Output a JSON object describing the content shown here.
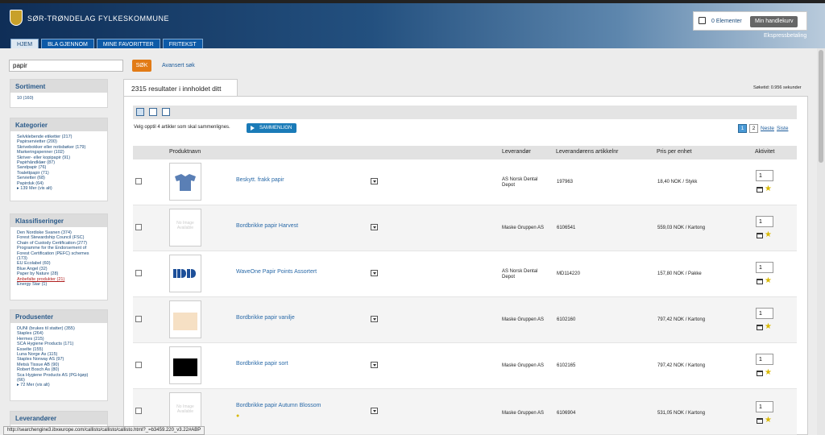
{
  "header": {
    "org_name": "SØR-TRØNDELAG FYLKESKOMMUNE",
    "nav": [
      "HJEM",
      "BLA GJENNOM",
      "MINE FAVORITTER",
      "FRITEKST"
    ],
    "cart_count": "0 Elementer",
    "cart_button": "Min handlekurv",
    "express": "Ekspressbetaling"
  },
  "search": {
    "value": "papir",
    "button": "SØK",
    "advanced": "Avansert søk"
  },
  "sidebar": {
    "sortiment": {
      "title": "Sortiment",
      "items": [
        "10 (160)"
      ]
    },
    "kategorier": {
      "title": "Kategorier",
      "items": [
        "Selvklebende etiketter (217)",
        "Papirservietter (200)",
        "Skrivebokker eller notisbøker (179)",
        "Markeringspenner (102)",
        "Skriver- eller kopipapir (91)",
        "Papirhåndklær (87)",
        "Sandpapir (76)",
        "Toalettpapir (71)",
        "Servietter (68)",
        "Papirduk (64)"
      ],
      "more": "139 Mer (vis alt)"
    },
    "klassifiseringer": {
      "title": "Klassifiseringer",
      "items": [
        "Den Nordiske Svanen (374)",
        "Forest Stewardship Council (FSC)",
        "Chain of Custody Certification (277)",
        "Programme for the Endorsement of",
        "Forest Certification (PEFC) schemes",
        "(173)",
        "EU Ecolabel (60)",
        "Blue Angel (32)",
        "Paper by Nature (28)"
      ],
      "highlight": "Anbefalte produkter (21)",
      "last": "Energy Star (1)"
    },
    "produsenter": {
      "title": "Produsenter",
      "items": [
        "DUNI (brukes til statter) (355)",
        "Staples (264)",
        "Hermes (215)",
        "SCA Hygiene Products (171)",
        "Esselte (155)",
        "Luna Norge As (115)",
        "Staples Norway AS (97)",
        "Metsä Tissue AB (90)",
        "Robert Bosch As (80)",
        "Sca Hygiene Products AS (PG-kjøp)",
        "(66)"
      ],
      "more": "72 Mer (vis alt)"
    },
    "leverandorer": {
      "title": "Leverandører"
    }
  },
  "results": {
    "tab_label": "2315 resultater i innholdet ditt",
    "search_time": "Søketid: 0.956 sekunder",
    "compare_hint": "Velg opptil 4 artikler som skal sammenlignes.",
    "compare_button": "SAMMENLIGN",
    "pages": [
      "1",
      "2"
    ],
    "next": "Neste",
    "last": "Siste",
    "columns": [
      "Produktnavn",
      "Leverandør",
      "Leverandørens artikkelnr",
      "Pris per enhet",
      "Aktivitet"
    ],
    "no_image": "No Image Available",
    "rows": [
      {
        "name": "Beskytt. frakk papir",
        "supplier": "AS Norsk Dental Depot",
        "article": "197963",
        "price": "18,40 NOK /",
        "unit": "Stykk",
        "qty": "1"
      },
      {
        "name": "Bordbrikke papir Harvest",
        "supplier": "Maske Gruppen AS",
        "article": "6106541",
        "price": "559,03 NOK /",
        "unit": "Kartong",
        "qty": "1"
      },
      {
        "name": "WaveOne Papir Points Assortert",
        "supplier": "AS Norsk Dental Depot",
        "article": "MD114220",
        "price": "157,80 NOK /",
        "unit": "Pakke",
        "qty": "1"
      },
      {
        "name": "Bordbrikke papir vanilje",
        "supplier": "Maske Gruppen AS",
        "article": "6102160",
        "price": "797,42 NOK /",
        "unit": "Kartong",
        "qty": "1"
      },
      {
        "name": "Bordbrikke papir sort",
        "supplier": "Maske Gruppen AS",
        "article": "6102165",
        "price": "797,42 NOK /",
        "unit": "Kartong",
        "qty": "1"
      },
      {
        "name": "Bordbrikke papir Autumn Blossom",
        "supplier": "Maske Gruppen AS",
        "article": "6106904",
        "price": "531,05 NOK /",
        "unit": "Kartong",
        "qty": "1"
      }
    ]
  },
  "status_url": "http://searchengine3.ibxeurope.com/callisto/callisto/callisto.html?_=b3459.220_v3.22#ABP"
}
